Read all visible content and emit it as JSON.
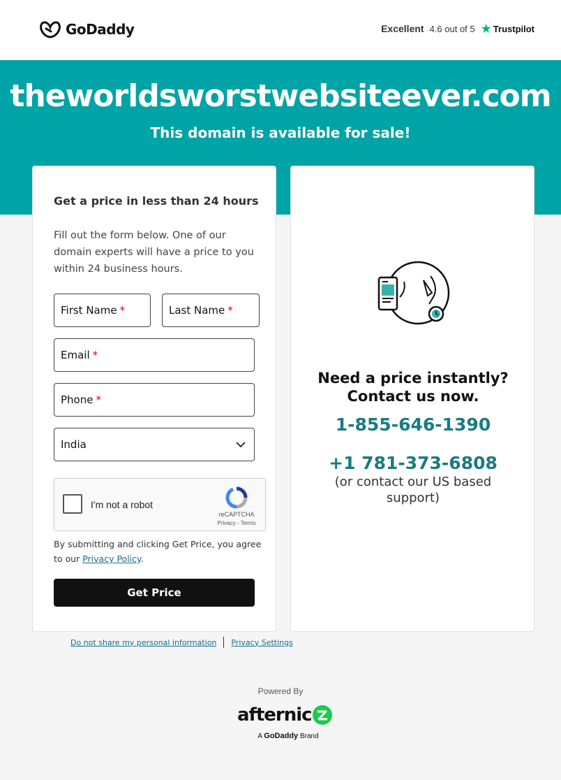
{
  "header": {
    "logo_text": "GoDaddy",
    "trustpilot": {
      "rating_word": "Excellent",
      "score_text": "4.6 out of 5",
      "brand": "Trustpilot"
    }
  },
  "hero": {
    "domain": "theworldsworstwebsiteever.com",
    "subtitle": "This domain is available for sale!"
  },
  "form": {
    "title": "Get a price in less than 24 hours",
    "description": "Fill out the form below. One of our domain experts will have a price to you within 24 business hours.",
    "first_name_label": "First Name",
    "last_name_label": "Last Name",
    "email_label": "Email",
    "phone_label": "Phone",
    "required_mark": "*",
    "country_value": "India",
    "captcha_label": "I'm not a robot",
    "captcha_brand": "reCAPTCHA",
    "captcha_links": "Privacy - Terms",
    "agree_text": "By submitting and clicking Get Price, you agree to our",
    "privacy_link": "Privacy Policy",
    "agree_end": ".",
    "submit_label": "Get Price"
  },
  "contact": {
    "heading_line1": "Need a price instantly?",
    "heading_line2": "Contact us now.",
    "phone_primary": "1-855-646-1390",
    "phone_secondary": "+1 781-373-6808",
    "phone_note": "(or contact our US based support)"
  },
  "footer": {
    "do_not_share": "Do not share my personal information",
    "privacy_settings": "Privacy Settings",
    "powered_by": "Powered By",
    "afternic": "afternic",
    "brand_prefix": "A",
    "brand_name": "GoDaddy",
    "brand_suffix": "Brand"
  },
  "colors": {
    "accent": "#00a4a6",
    "phone": "#1a7b81",
    "trustpilot_star": "#00b67a"
  }
}
